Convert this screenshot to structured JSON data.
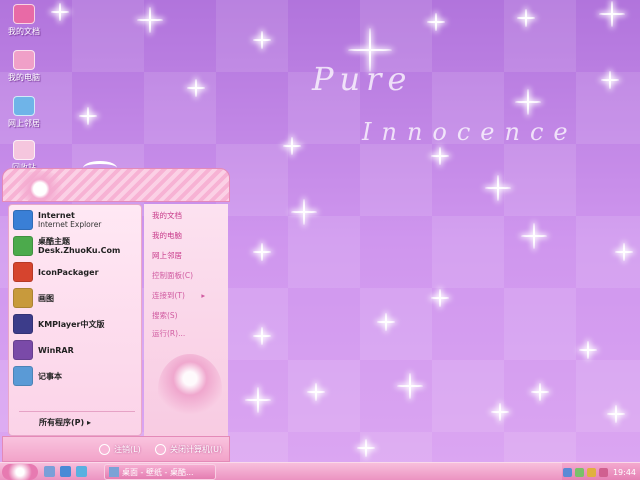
{
  "wallpaper": {
    "title_line1": "Pure",
    "title_line2": "Innocence"
  },
  "desktop_icons": [
    {
      "label": "我的文档",
      "icon": "my-documents-icon",
      "color": "#e86aa6"
    },
    {
      "label": "我的电脑",
      "icon": "my-computer-icon",
      "color": "#f0a0c8"
    },
    {
      "label": "网上邻居",
      "icon": "network-icon",
      "color": "#6fb4e8"
    },
    {
      "label": "回收站",
      "icon": "recycle-bin-icon",
      "color": "#f5c6de"
    }
  ],
  "start_menu": {
    "programs": [
      {
        "name": "Internet",
        "sub": "Internet Explorer",
        "icon": "internet-explorer-icon",
        "color": "#3a7fd6"
      },
      {
        "name": "桌酷主题",
        "sub": "Desk.ZhuoKu.Com",
        "icon": "zhuoku-theme-icon",
        "color": "#4caa4c"
      },
      {
        "name": "IconPackager",
        "sub": "",
        "icon": "iconpackager-icon",
        "color": "#d6442e"
      },
      {
        "name": "画图",
        "sub": "",
        "icon": "paint-icon",
        "color": "#c89a3c"
      },
      {
        "name": "KMPlayer中文版",
        "sub": "",
        "icon": "kmplayer-icon",
        "color": "#3c3c8a"
      },
      {
        "name": "WinRAR",
        "sub": "",
        "icon": "winrar-icon",
        "color": "#7a4aa8"
      },
      {
        "name": "记事本",
        "sub": "",
        "icon": "notepad-icon",
        "color": "#5a9ad6"
      }
    ],
    "all_programs": "所有程序(P) ▸",
    "places_main": [
      "我的文档",
      "我的电脑",
      "网上邻居"
    ],
    "places_secondary": [
      "控制面板(C)",
      "连接到(T)",
      "搜索(S)",
      "运行(R)..."
    ],
    "connect_arrow": "▸",
    "logoff": "注销(L)",
    "shutdown": "关闭计算机(U)"
  },
  "taskbar": {
    "task_label": "桌面 - 壁纸 - 桌酷...",
    "clock": "19:44",
    "accent": "#eb93c1"
  }
}
